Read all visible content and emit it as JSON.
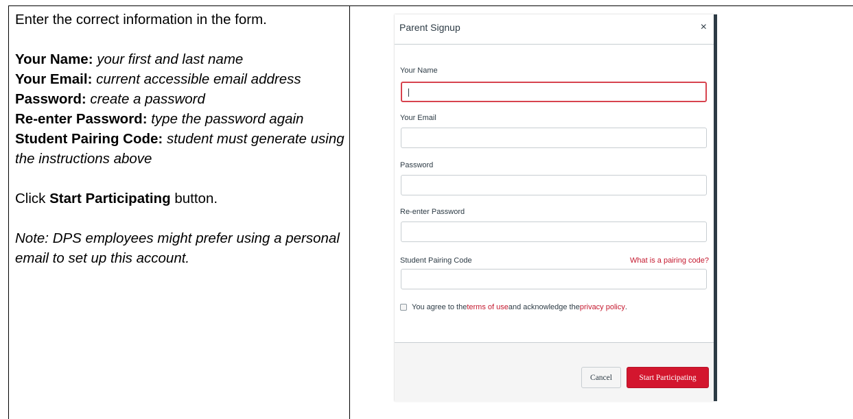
{
  "instructions": {
    "intro": "Enter the correct information in the form.",
    "fields": [
      {
        "label": "Your Name:",
        "desc": "your first and last name"
      },
      {
        "label": "Your Email:",
        "desc": "current accessible email address"
      },
      {
        "label": "Password:",
        "desc": "create a password"
      },
      {
        "label": "Re-enter Password:",
        "desc": "type the password again"
      },
      {
        "label": "Student Pairing Code:",
        "desc": "student must generate using the instructions above"
      }
    ],
    "click_prefix": "Click ",
    "click_button": "Start Participating",
    "click_suffix": " button.",
    "note": "Note: DPS employees might prefer using a personal email to set up this account."
  },
  "modal": {
    "title": "Parent Signup",
    "close_glyph": "×",
    "fields": {
      "name": {
        "label": "Your Name",
        "value": ""
      },
      "email": {
        "label": "Your Email",
        "value": ""
      },
      "password": {
        "label": "Password",
        "value": ""
      },
      "password_confirm": {
        "label": "Re-enter Password",
        "value": ""
      },
      "pairing_code": {
        "label": "Student Pairing Code",
        "value": "",
        "help_link": "What is a pairing code?"
      }
    },
    "agree": {
      "prefix": "You agree to the ",
      "terms": "terms of use",
      "middle": " and acknowledge the ",
      "privacy": "privacy policy",
      "suffix": "."
    },
    "buttons": {
      "cancel": "Cancel",
      "start": "Start Participating"
    }
  },
  "colors": {
    "accent_red": "#d3162e",
    "link_red": "#c4182e",
    "text_dark": "#2d3b45",
    "border": "#c7cdd1"
  }
}
